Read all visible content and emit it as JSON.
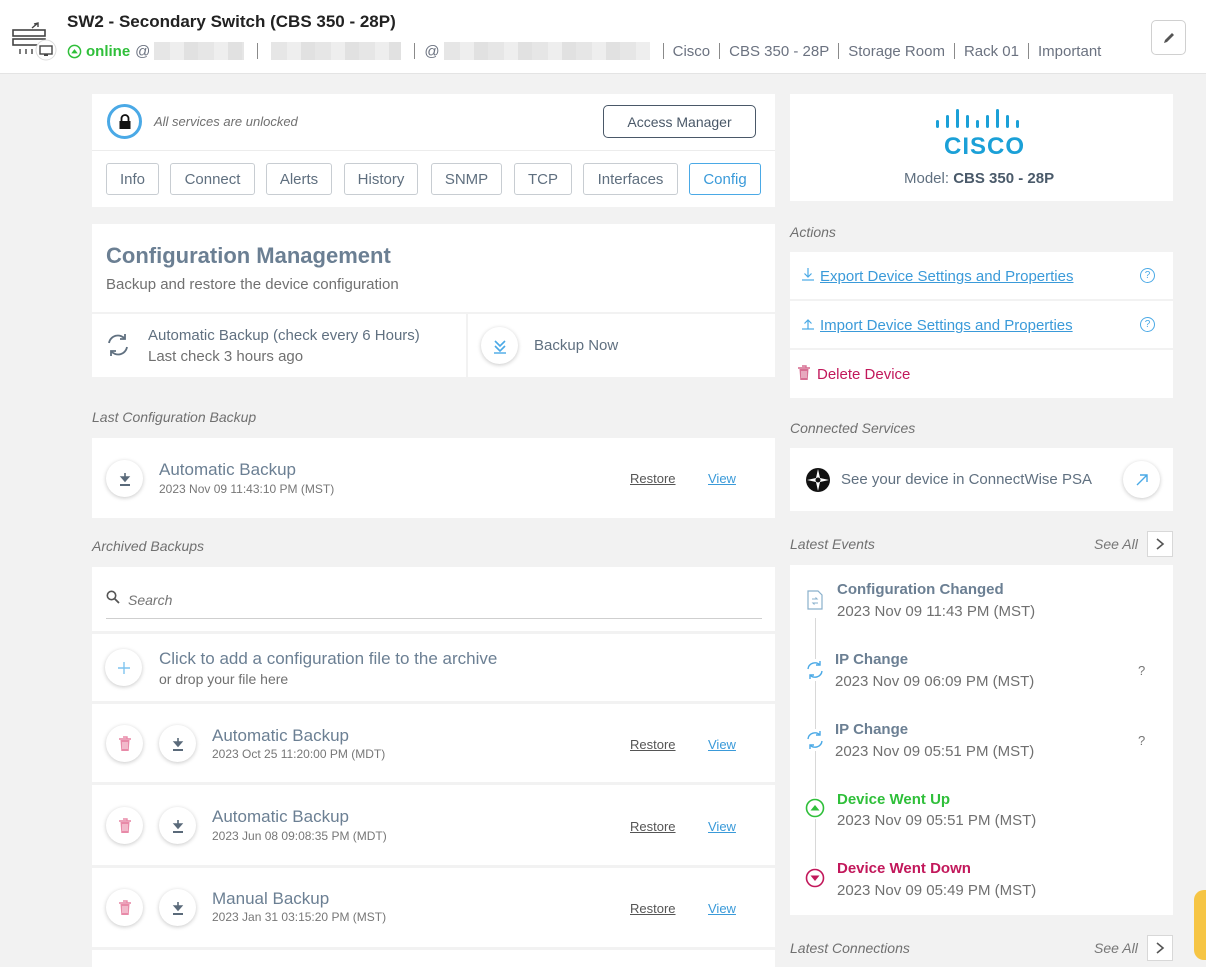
{
  "device": {
    "title": "SW2 - Secondary Switch (CBS 350 - 28P)",
    "status": "online",
    "at": "@",
    "vendor": "Cisco",
    "model": "CBS 350 - 28P",
    "location": "Storage Room",
    "rack": "Rack 01",
    "tag": "Important"
  },
  "services": {
    "unlocked_text": "All services are unlocked",
    "access_manager_label": "Access Manager"
  },
  "tabs": [
    {
      "label": "Info"
    },
    {
      "label": "Connect"
    },
    {
      "label": "Alerts"
    },
    {
      "label": "History"
    },
    {
      "label": "SNMP"
    },
    {
      "label": "TCP"
    },
    {
      "label": "Interfaces"
    },
    {
      "label": "Config"
    }
  ],
  "config": {
    "title": "Configuration Management",
    "subtitle": "Backup and restore the device configuration",
    "auto_backup_label": "Automatic Backup (check every 6 Hours)",
    "last_check": "Last check 3 hours ago",
    "backup_now_label": "Backup Now"
  },
  "last_backup": {
    "section_label": "Last Configuration Backup",
    "name": "Automatic Backup",
    "date": "2023 Nov 09 11:43:10 PM (MST)",
    "restore_label": "Restore",
    "view_label": "View"
  },
  "archived": {
    "section_label": "Archived Backups",
    "search_placeholder": "Search",
    "add_title": "Click to add a configuration file to the archive",
    "add_sub": "or drop your file here",
    "restore_label": "Restore",
    "view_label": "View",
    "items": [
      {
        "name": "Automatic Backup",
        "date": "2023 Oct 25 11:20:00 PM (MDT)"
      },
      {
        "name": "Automatic Backup",
        "date": "2023 Jun 08 09:08:35 PM (MDT)"
      },
      {
        "name": "Manual Backup",
        "date": "2023 Jan 31 03:15:20 PM (MST)"
      }
    ]
  },
  "brand": {
    "logo_text": "CISCO",
    "model_label": "Model:",
    "model_value": "CBS 350 - 28P"
  },
  "actions": {
    "section_label": "Actions",
    "export_label": "Export Device Settings and Properties",
    "import_label": "Import Device Settings and Properties",
    "help_glyph": "?",
    "delete_label": "Delete Device"
  },
  "connected_services": {
    "section_label": "Connected Services",
    "psa_text": "See your device in ConnectWise PSA"
  },
  "events": {
    "section_label": "Latest Events",
    "see_all_label": "See All",
    "help_glyph": "?",
    "items": [
      {
        "title": "Configuration Changed",
        "date": "2023 Nov 09 11:43 PM (MST)"
      },
      {
        "title": "IP Change",
        "date": "2023 Nov 09 06:09 PM (MST)"
      },
      {
        "title": "IP Change",
        "date": "2023 Nov 09 05:51 PM (MST)"
      },
      {
        "title": "Device Went Up",
        "date": "2023 Nov 09 05:51 PM (MST)"
      },
      {
        "title": "Device Went Down",
        "date": "2023 Nov 09 05:49 PM (MST)"
      }
    ]
  },
  "connections": {
    "section_label": "Latest Connections",
    "see_all_label": "See All"
  },
  "colors": {
    "accent_blue": "#3a9ad9",
    "online_green": "#2fbf3a",
    "delete_pink": "#c2185b",
    "event_up_green": "#2fbf3a",
    "event_down_pink": "#c2185b"
  },
  "icons": {
    "device": "switch-icon",
    "status": "online-arrow-up-icon",
    "edit": "pencil-icon",
    "lock": "lock-icon",
    "sync": "sync-icon",
    "backup_now": "double-chevron-down-icon",
    "download": "download-icon",
    "delete": "trash-icon",
    "add": "plus-icon",
    "search": "search-icon",
    "export": "download-arrow-icon",
    "import": "upload-arrow-icon",
    "connectwise": "connectwise-logo-icon",
    "external": "external-link-arrow-icon",
    "chevron": "chevron-right-icon",
    "doc": "document-icon"
  }
}
